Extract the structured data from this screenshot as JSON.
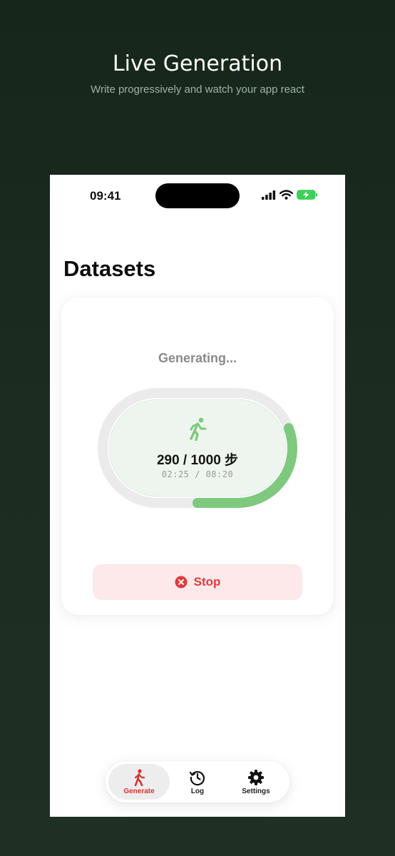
{
  "promo": {
    "title": "Live Generation",
    "subtitle": "Write progressively and watch your app react"
  },
  "status_bar": {
    "time": "09:41",
    "icons": [
      "signal-icon",
      "wifi-icon",
      "battery-charging-icon"
    ]
  },
  "page": {
    "title": "Datasets"
  },
  "generation": {
    "status": "Generating...",
    "steps": "290 / 1000 步",
    "time": "02:25 / 08:20",
    "progress": 0.29,
    "progress_color": "#7ec97e",
    "track_color": "#ebebeb",
    "inner_color": "#eef5ee",
    "icon": "running-person-icon"
  },
  "stop_button": {
    "label": "Stop",
    "icon": "close-circle-icon",
    "color": "#e23a3a"
  },
  "tabbar": {
    "tabs": [
      {
        "label": "Generate",
        "icon": "walking-person-icon",
        "active": true
      },
      {
        "label": "Log",
        "icon": "history-icon",
        "active": false
      },
      {
        "label": "Settings",
        "icon": "gear-icon",
        "active": false
      }
    ]
  }
}
